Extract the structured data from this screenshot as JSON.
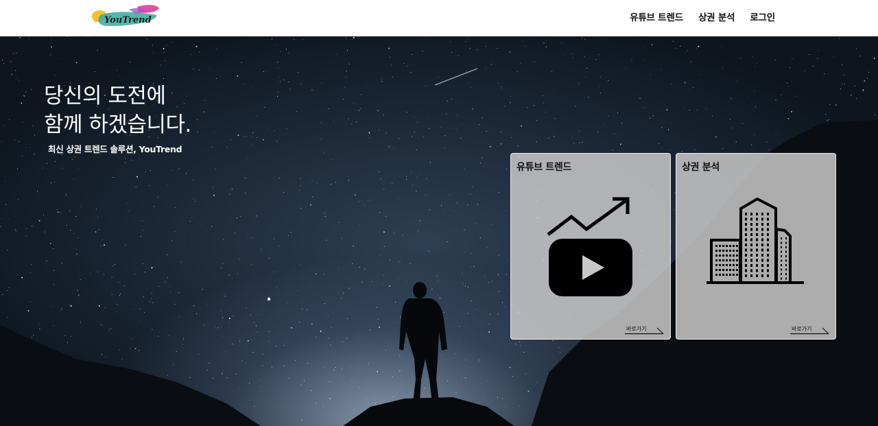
{
  "brand": {
    "logo_text": "YouTrend"
  },
  "nav": {
    "items": [
      {
        "label": "유튜브 트렌드"
      },
      {
        "label": "상권 분석"
      },
      {
        "label": "로그인"
      }
    ]
  },
  "hero": {
    "title_line1": "당신의 도전에",
    "title_line2": "함께 하겠습니다.",
    "subtitle": "최신 상권 트렌드 솔루션, YouTrend"
  },
  "cards": [
    {
      "title": "유튜브 트렌드",
      "icon": "youtube-trend-icon",
      "link_label": "바로가기"
    },
    {
      "title": "상권 분석",
      "icon": "buildings-icon",
      "link_label": "바로가기"
    }
  ],
  "colors": {
    "header_bg": "#ffffff",
    "card_bg": "#c8c8c8",
    "text_dark": "#111111",
    "hero_text": "#ffffff"
  }
}
